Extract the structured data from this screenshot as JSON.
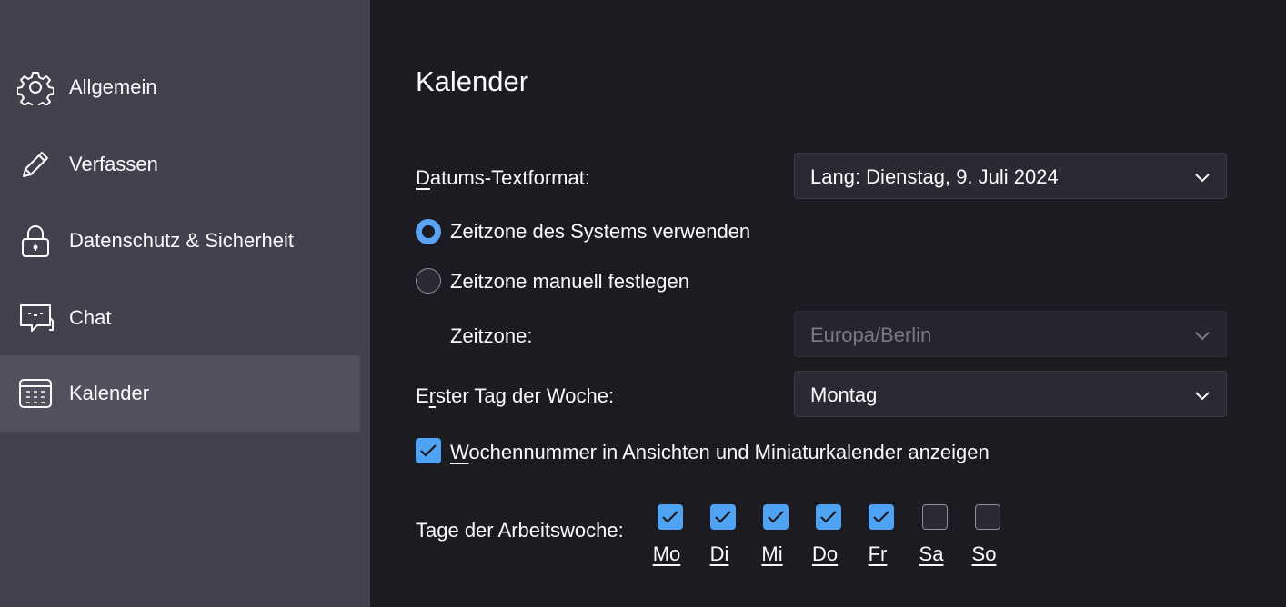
{
  "sidebar": {
    "items": [
      {
        "label": "Allgemein",
        "icon": "gear-icon"
      },
      {
        "label": "Verfassen",
        "icon": "pencil-icon"
      },
      {
        "label": "Datenschutz & Sicherheit",
        "icon": "lock-icon"
      },
      {
        "label": "Chat",
        "icon": "chat-icon"
      },
      {
        "label": "Kalender",
        "icon": "calendar-icon",
        "selected": true
      }
    ]
  },
  "main": {
    "title": "Kalender",
    "date_format": {
      "label_first": "D",
      "label_rest": "atums-Textformat:",
      "value": "Lang: Dienstag, 9. Juli 2024"
    },
    "timezone_system": {
      "label": "Zeitzone des Systems verwenden",
      "checked": true
    },
    "timezone_manual": {
      "label": "Zeitzone manuell festlegen",
      "checked": false
    },
    "timezone": {
      "label": "Zeitzone:",
      "value": "Europa/Berlin",
      "disabled": true
    },
    "first_day": {
      "label_first": "E",
      "label_u": "r",
      "label_rest": "ster Tag der Woche:",
      "value": "Montag"
    },
    "week_numbers": {
      "label_u": "W",
      "label_rest": "ochennummer in Ansichten und Miniaturkalender anzeigen",
      "checked": true
    },
    "workweek": {
      "label": "Tage der Arbeitswoche:",
      "days": [
        {
          "label": "Mo",
          "checked": true
        },
        {
          "label": "Di",
          "checked": true
        },
        {
          "label": "Mi",
          "checked": true
        },
        {
          "label": "Do",
          "checked": true
        },
        {
          "label": "Fr",
          "checked": true
        },
        {
          "label": "Sa",
          "checked": false
        },
        {
          "label": "So",
          "checked": false
        }
      ]
    }
  },
  "colors": {
    "accent": "#4ea3f5",
    "sidebar_bg": "#42414d",
    "main_bg": "#1c1b22",
    "selected_bg": "#52525e"
  }
}
